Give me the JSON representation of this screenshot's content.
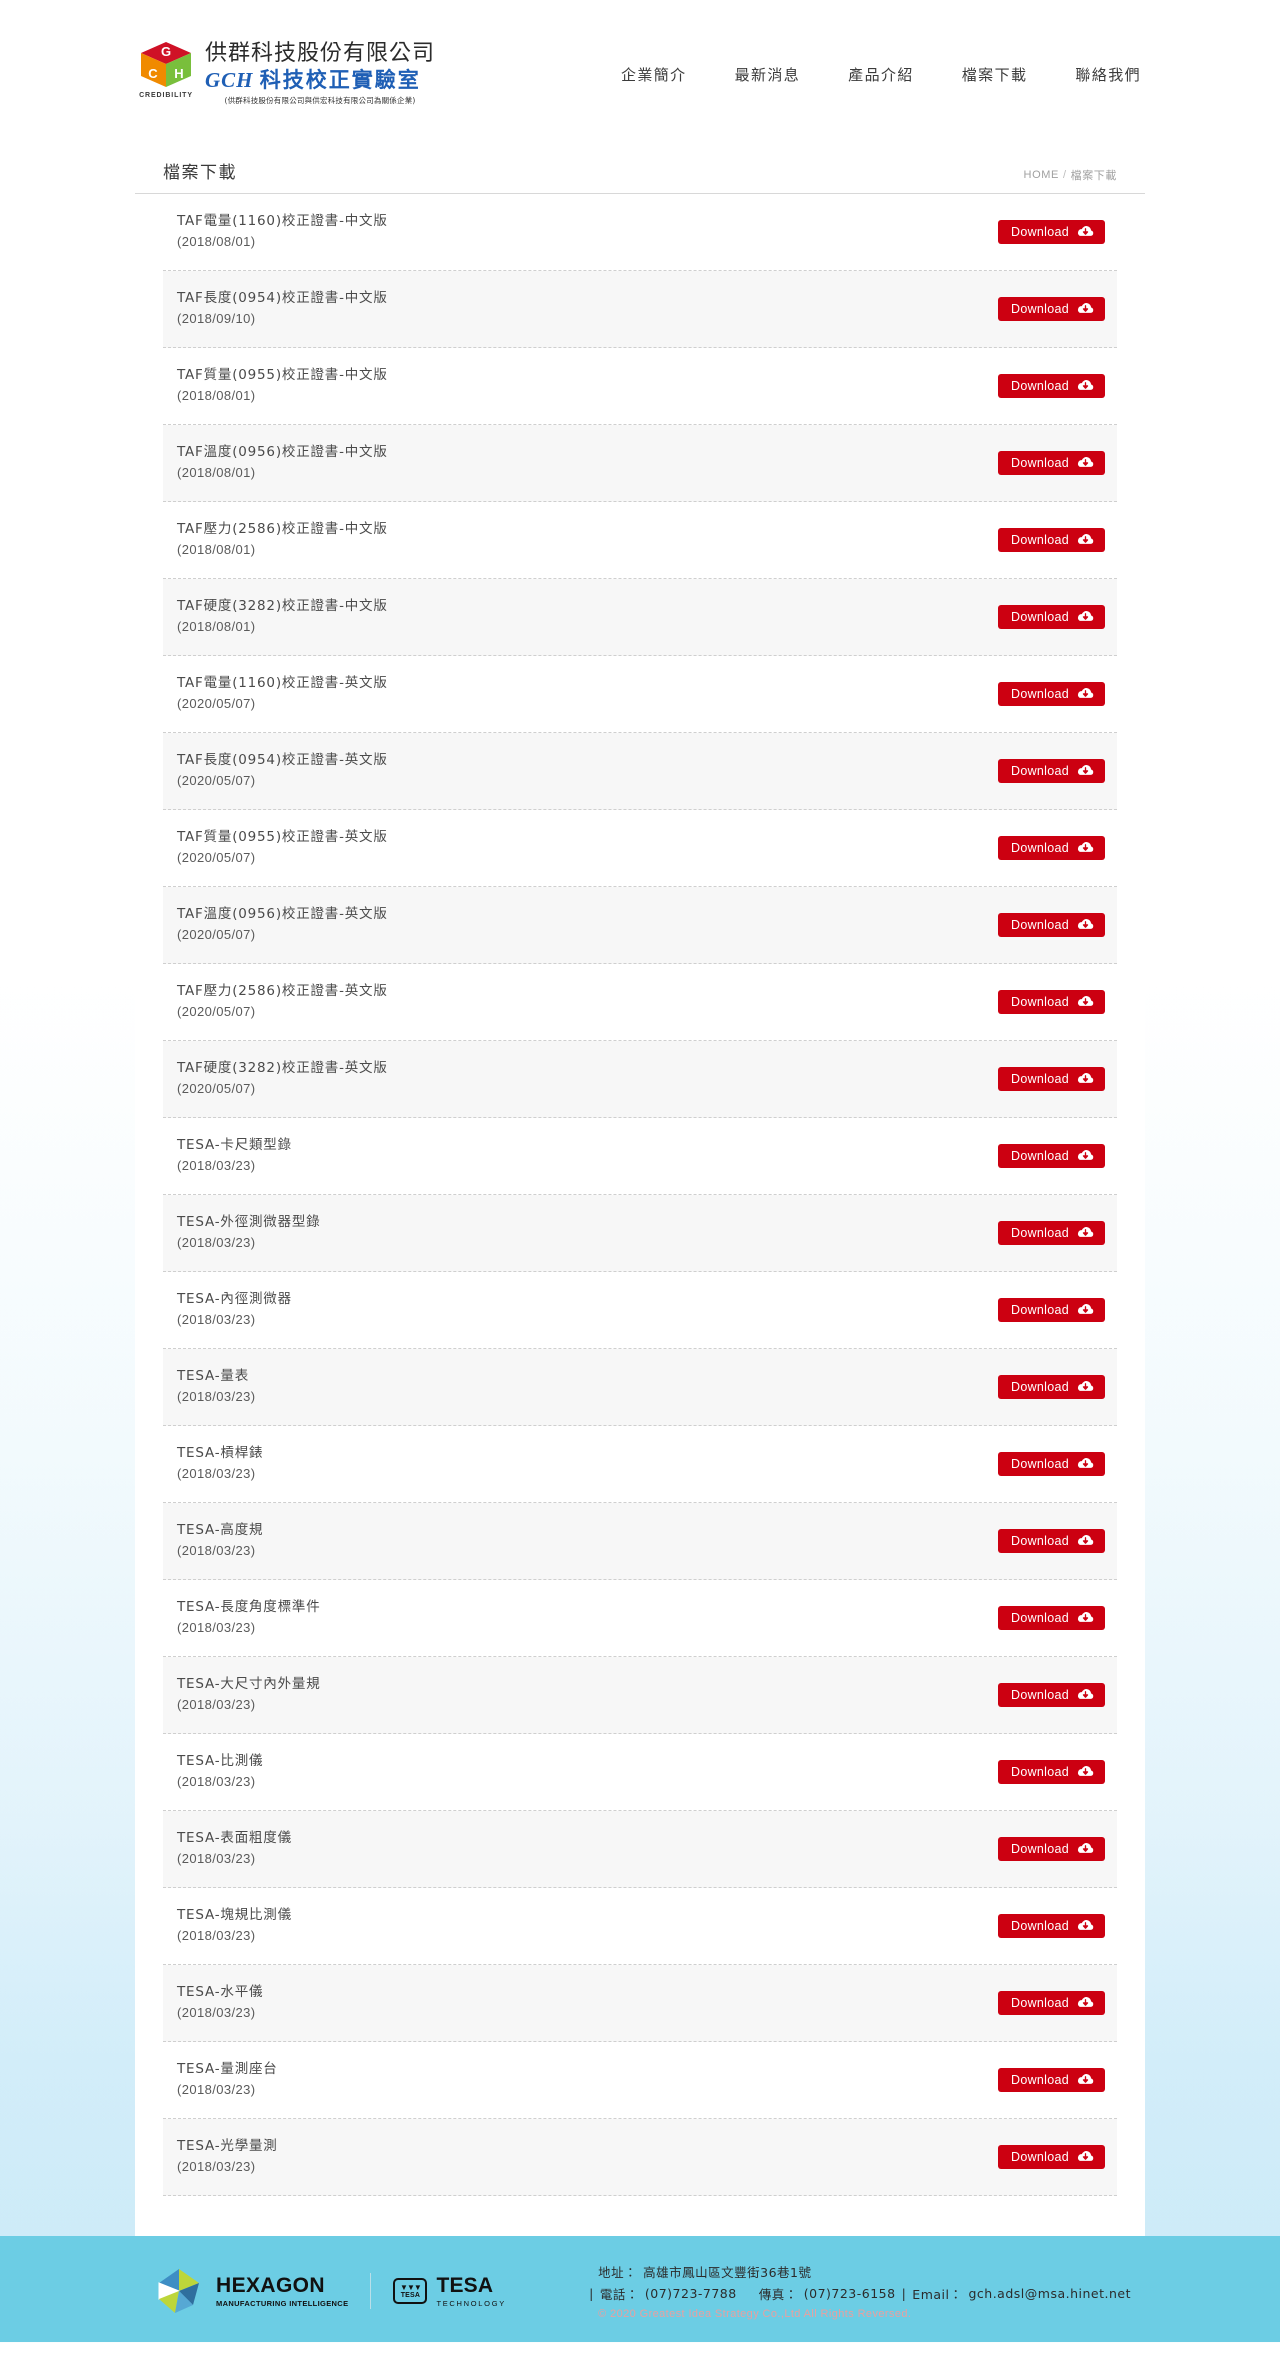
{
  "header": {
    "logo": {
      "mark_icon": "gch-cube-logo-icon",
      "credibility_text": "CREDIBILITY",
      "company_name": "供群科技股份有限公司",
      "brand_latin": "GCH",
      "brand_cjk": "科技校正實驗室",
      "affiliate_note": "(供群科技股份有限公司與供宏科技有限公司為關係企業)"
    },
    "nav": [
      {
        "label": "企業簡介",
        "name": "nav-about"
      },
      {
        "label": "最新消息",
        "name": "nav-news"
      },
      {
        "label": "產品介紹",
        "name": "nav-products"
      },
      {
        "label": "檔案下載",
        "name": "nav-downloads"
      },
      {
        "label": "聯絡我們",
        "name": "nav-contact"
      }
    ]
  },
  "main": {
    "page_title": "檔案下載",
    "breadcrumb": {
      "home": "HOME",
      "separator": "/",
      "current": "檔案下載"
    },
    "download_button_label": "Download",
    "download_icon": "cloud-download-icon",
    "items": [
      {
        "name": "TAF電量(1160)校正證書-中文版",
        "date": "(2018/08/01)"
      },
      {
        "name": "TAF長度(0954)校正證書-中文版",
        "date": "(2018/09/10)"
      },
      {
        "name": "TAF質量(0955)校正證書-中文版",
        "date": "(2018/08/01)"
      },
      {
        "name": "TAF溫度(0956)校正證書-中文版",
        "date": "(2018/08/01)"
      },
      {
        "name": "TAF壓力(2586)校正證書-中文版",
        "date": "(2018/08/01)"
      },
      {
        "name": "TAF硬度(3282)校正證書-中文版",
        "date": "(2018/08/01)"
      },
      {
        "name": "TAF電量(1160)校正證書-英文版",
        "date": "(2020/05/07)"
      },
      {
        "name": "TAF長度(0954)校正證書-英文版",
        "date": "(2020/05/07)"
      },
      {
        "name": "TAF質量(0955)校正證書-英文版",
        "date": "(2020/05/07)"
      },
      {
        "name": "TAF溫度(0956)校正證書-英文版",
        "date": "(2020/05/07)"
      },
      {
        "name": "TAF壓力(2586)校正證書-英文版",
        "date": "(2020/05/07)"
      },
      {
        "name": "TAF硬度(3282)校正證書-英文版",
        "date": "(2020/05/07)"
      },
      {
        "name": "TESA-卡尺類型錄",
        "date": "(2018/03/23)"
      },
      {
        "name": "TESA-外徑測微器型錄",
        "date": "(2018/03/23)"
      },
      {
        "name": "TESA-內徑測微器",
        "date": "(2018/03/23)"
      },
      {
        "name": "TESA-量表",
        "date": "(2018/03/23)"
      },
      {
        "name": "TESA-槓桿錶",
        "date": "(2018/03/23)"
      },
      {
        "name": "TESA-高度規",
        "date": "(2018/03/23)"
      },
      {
        "name": "TESA-長度角度標準件",
        "date": "(2018/03/23)"
      },
      {
        "name": "TESA-大尺寸內外量規",
        "date": "(2018/03/23)"
      },
      {
        "name": "TESA-比測儀",
        "date": "(2018/03/23)"
      },
      {
        "name": "TESA-表面粗度儀",
        "date": "(2018/03/23)"
      },
      {
        "name": "TESA-塊規比測儀",
        "date": "(2018/03/23)"
      },
      {
        "name": "TESA-水平儀",
        "date": "(2018/03/23)"
      },
      {
        "name": "TESA-量測座台",
        "date": "(2018/03/23)"
      },
      {
        "name": "TESA-光學量測",
        "date": "(2018/03/23)"
      }
    ]
  },
  "footer": {
    "hexagon": {
      "mark_icon": "hexagon-logo-icon",
      "name": "HEXAGON",
      "tagline": "MANUFACTURING INTELLIGENCE"
    },
    "tesa": {
      "mark_icon": "tesa-logo-icon",
      "mark_label": "TESA",
      "name": "TESA",
      "tagline": "TECHNOLOGY"
    },
    "address_label": "地址：",
    "address_value": "高雄市鳳山區文豐街36巷1號",
    "phone_label": "電話：",
    "phone_value": "(07)723-7788",
    "fax_label": "傳真：",
    "fax_value": "(07)723-6158",
    "email_label": "Email：",
    "email_value": "gch.adsl@msa.hinet.net",
    "copyright": "© 2020 Greatest Idea Strategy Co.,Ltd All Rights Reversed."
  },
  "colors": {
    "accent_red": "#cc0011",
    "brand_blue": "#1f5fb5",
    "footer_cyan": "#6ccde4"
  }
}
